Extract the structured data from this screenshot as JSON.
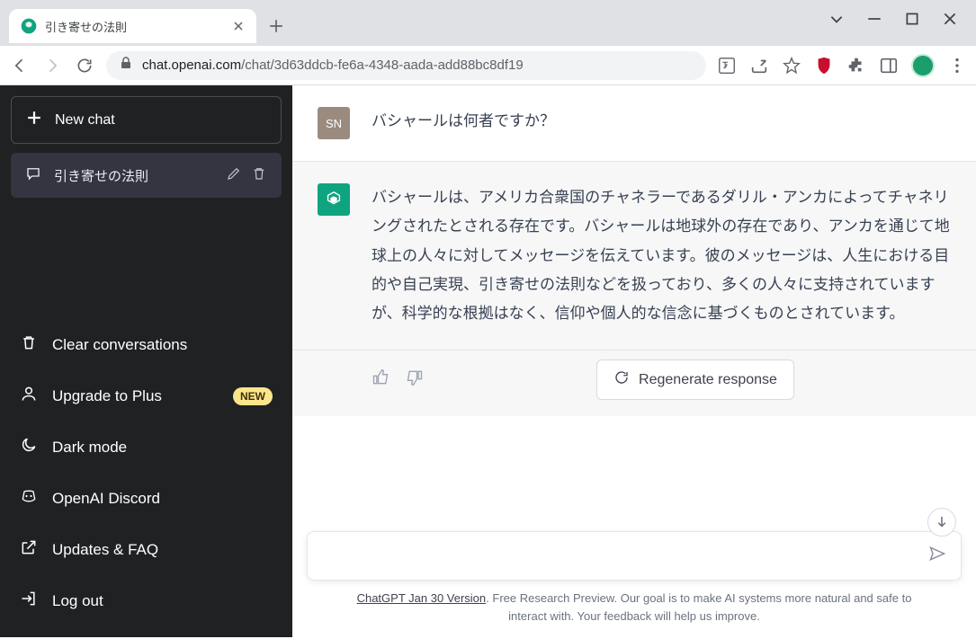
{
  "browser": {
    "tab_title": "引き寄せの法則",
    "url_domain": "chat.openai.com",
    "url_path": "/chat/3d63ddcb-fe6a-4348-aada-add88bc8df19"
  },
  "sidebar": {
    "new_chat": "New chat",
    "conversations": [
      {
        "title": "引き寄せの法則"
      }
    ],
    "bottom": [
      {
        "id": "clear",
        "label": "Clear conversations"
      },
      {
        "id": "upgrade",
        "label": "Upgrade to Plus",
        "badge": "NEW"
      },
      {
        "id": "dark",
        "label": "Dark mode"
      },
      {
        "id": "discord",
        "label": "OpenAI Discord"
      },
      {
        "id": "updates",
        "label": "Updates & FAQ"
      },
      {
        "id": "logout",
        "label": "Log out"
      }
    ]
  },
  "chat": {
    "user_avatar": "SN",
    "user_message": "バシャールは何者ですか？",
    "assistant_message": "バシャールは、アメリカ合衆国のチャネラーであるダリル・アンカによってチャネリングされたとされる存在です。バシャールは地球外の存在であり、アンカを通じて地球上の人々に対してメッセージを伝えています。彼のメッセージは、人生における目的や自己実現、引き寄せの法則などを扱っており、多くの人々に支持されていますが、科学的な根拠はなく、信仰や個人的な信念に基づくものとされています。",
    "regenerate": "Regenerate response"
  },
  "footer": {
    "version_link": "ChatGPT Jan 30 Version",
    "text": ". Free Research Preview. Our goal is to make AI systems more natural and safe to interact with. Your feedback will help us improve."
  }
}
